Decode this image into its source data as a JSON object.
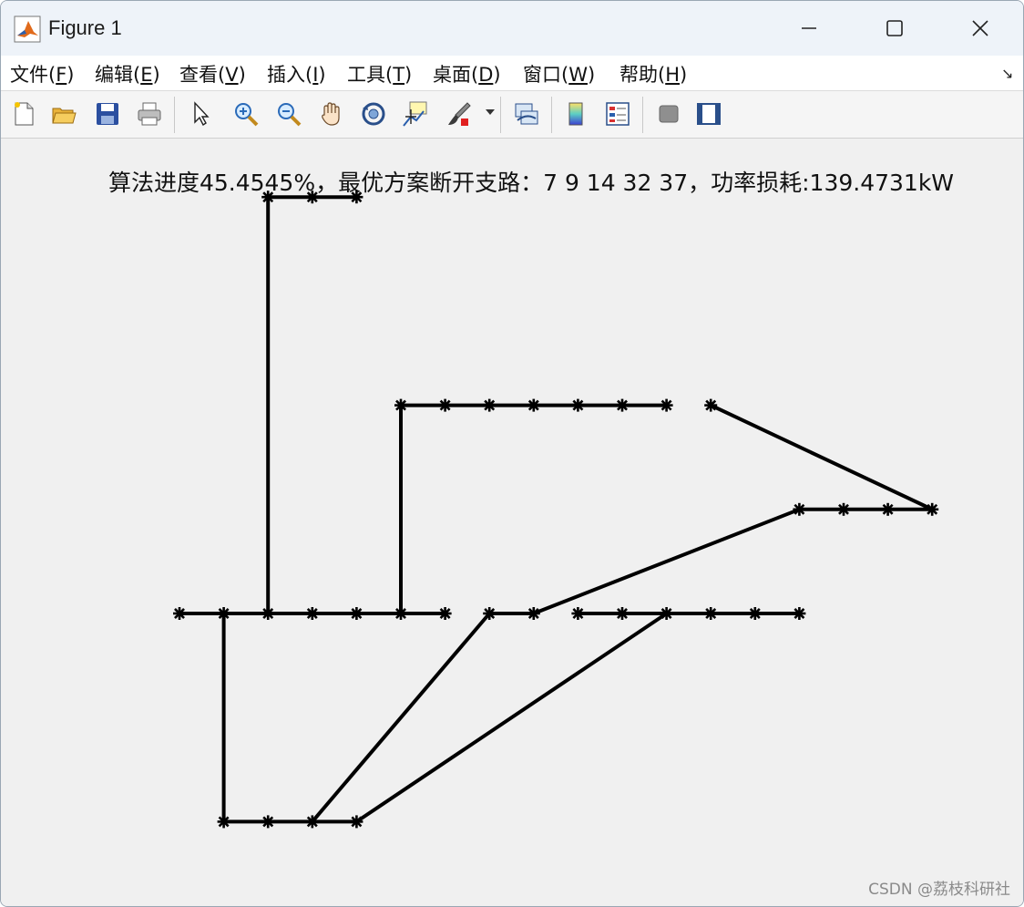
{
  "window": {
    "title": "Figure 1",
    "icon": "matlab-icon",
    "controls": [
      "minimize-icon",
      "maximize-icon",
      "close-icon"
    ]
  },
  "menu": [
    {
      "label": "文件(",
      "key": "F",
      "suffix": ")"
    },
    {
      "label": "编辑(",
      "key": "E",
      "suffix": ")"
    },
    {
      "label": "查看(",
      "key": "V",
      "suffix": ")"
    },
    {
      "label": "插入(",
      "key": "I",
      "suffix": ")"
    },
    {
      "label": "工具(",
      "key": "T",
      "suffix": ")"
    },
    {
      "label": "桌面(",
      "key": "D",
      "suffix": ")"
    },
    {
      "label": "窗口(",
      "key": "W",
      "suffix": ")"
    },
    {
      "label": "帮助(",
      "key": "H",
      "suffix": ")"
    }
  ],
  "toolbar": [
    "new-figure-icon",
    "open-icon",
    "save-icon",
    "print-icon",
    "pointer-icon",
    "zoom-in-icon",
    "zoom-out-icon",
    "pan-icon",
    "rotate-icon",
    "data-cursor-icon",
    "brush-icon",
    "link-icon",
    "colorbar-icon",
    "legend-icon",
    "hide-plot-tools-icon",
    "show-plot-tools-icon"
  ],
  "plot": {
    "title": "算法进度45.4545%，最优方案断开支路：7   9  14  32  37，功率损耗:139.4731kW",
    "watermark": "CSDN @荔枝科研社",
    "line_color": "#000000"
  },
  "chart_data": {
    "type": "line",
    "title": "算法进度45.4545%，最优方案断开支路：7   9  14  32  37，功率损耗:139.4731kW",
    "xlabel": "",
    "ylabel": "",
    "xlim": [
      1,
      18
    ],
    "ylim": [
      -3.2,
      10
    ],
    "grid": false,
    "axes_visible": false,
    "marker": "asterisk",
    "nodes": [
      {
        "id": 1,
        "x": 1,
        "y": 0
      },
      {
        "id": 2,
        "x": 2,
        "y": 0
      },
      {
        "id": 3,
        "x": 3,
        "y": 0
      },
      {
        "id": 4,
        "x": 4,
        "y": 0
      },
      {
        "id": 5,
        "x": 5,
        "y": 0
      },
      {
        "id": 6,
        "x": 6,
        "y": 0
      },
      {
        "id": 7,
        "x": 7,
        "y": 0
      },
      {
        "id": 8,
        "x": 8,
        "y": 0
      },
      {
        "id": 9,
        "x": 9,
        "y": 0
      },
      {
        "id": 10,
        "x": 10,
        "y": 0
      },
      {
        "id": 11,
        "x": 11,
        "y": 0
      },
      {
        "id": 12,
        "x": 12,
        "y": 0
      },
      {
        "id": 13,
        "x": 13,
        "y": 0
      },
      {
        "id": 14,
        "x": 14,
        "y": 0
      },
      {
        "id": 15,
        "x": 15,
        "y": 0
      },
      {
        "id": 16,
        "x": 3,
        "y": 8
      },
      {
        "id": 17,
        "x": 4,
        "y": 8
      },
      {
        "id": 18,
        "x": 5,
        "y": 8
      },
      {
        "id": 19,
        "x": 2,
        "y": -4
      },
      {
        "id": 20,
        "x": 3,
        "y": -4
      },
      {
        "id": 21,
        "x": 4,
        "y": -4
      },
      {
        "id": 22,
        "x": 5,
        "y": -4
      },
      {
        "id": 23,
        "x": 6,
        "y": 4
      },
      {
        "id": 24,
        "x": 7,
        "y": 4
      },
      {
        "id": 25,
        "x": 8,
        "y": 4
      },
      {
        "id": 26,
        "x": 9,
        "y": 4
      },
      {
        "id": 27,
        "x": 10,
        "y": 4
      },
      {
        "id": 28,
        "x": 11,
        "y": 4
      },
      {
        "id": 29,
        "x": 12,
        "y": 4
      },
      {
        "id": 30,
        "x": 13,
        "y": 4
      },
      {
        "id": 31,
        "x": 15,
        "y": 2
      },
      {
        "id": 32,
        "x": 16,
        "y": 2
      },
      {
        "id": 33,
        "x": 17,
        "y": 2
      },
      {
        "id": 34,
        "x": 18,
        "y": 2
      }
    ],
    "edges": [
      [
        1,
        2
      ],
      [
        2,
        3
      ],
      [
        3,
        4
      ],
      [
        4,
        5
      ],
      [
        5,
        6
      ],
      [
        6,
        7
      ],
      [
        8,
        9
      ],
      [
        10,
        11
      ],
      [
        11,
        12
      ],
      [
        12,
        13
      ],
      [
        13,
        14
      ],
      [
        14,
        15
      ],
      [
        3,
        16
      ],
      [
        16,
        17
      ],
      [
        17,
        18
      ],
      [
        2,
        19
      ],
      [
        19,
        20
      ],
      [
        20,
        21
      ],
      [
        21,
        22
      ],
      [
        6,
        23
      ],
      [
        23,
        24
      ],
      [
        24,
        25
      ],
      [
        25,
        26
      ],
      [
        26,
        27
      ],
      [
        27,
        28
      ],
      [
        28,
        29
      ],
      [
        30,
        34
      ],
      [
        31,
        32
      ],
      [
        32,
        33
      ],
      [
        33,
        34
      ],
      [
        9,
        31
      ],
      [
        21,
        8
      ],
      [
        22,
        12
      ]
    ]
  }
}
